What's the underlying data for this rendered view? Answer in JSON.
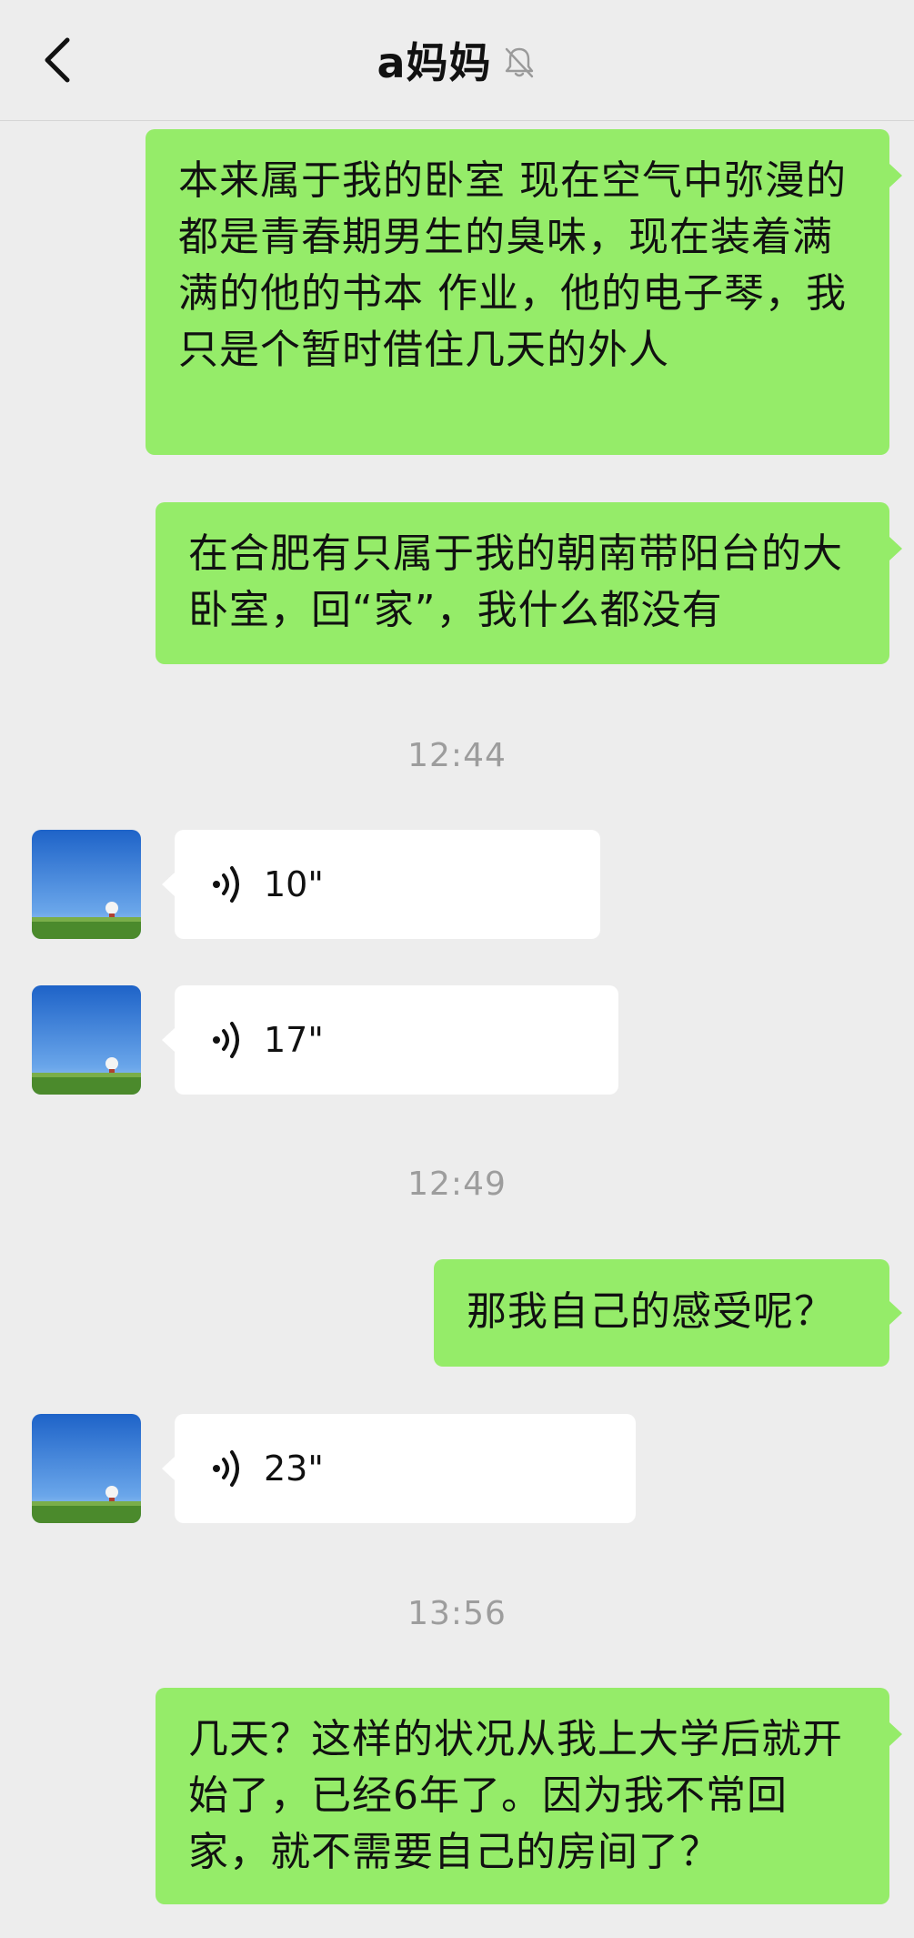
{
  "header": {
    "title": "a妈妈",
    "back_icon": "chevron-left-icon",
    "mute_icon": "bell-off-icon"
  },
  "colors": {
    "background": "#ededed",
    "outgoing_bubble": "#95ec69",
    "incoming_bubble": "#ffffff",
    "timestamp": "#9d9d9d"
  },
  "messages": {
    "m1": "本来属于我的卧室  现在空气中弥漫的都是青春期男生的臭味，现在装着满满的他的书本 作业，他的电子琴，我只是个暂时借住几天的外人",
    "m2": "在合肥有只属于我的朝南带阳台的大卧室，回“家”，我什么都没有",
    "ts1": "12:44",
    "v1": "10\"",
    "v2": "17\"",
    "ts2": "12:49",
    "m3": "那我自己的感受呢？",
    "v3": "23\"",
    "ts3": "13:56",
    "m4": "几天？这样的状况从我上大学后就开始了，已经6年了。因为我不常回家，就不需要自己的房间了？"
  }
}
